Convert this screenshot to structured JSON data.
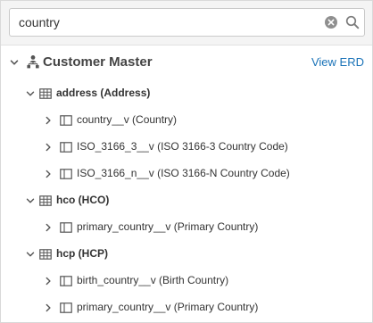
{
  "search": {
    "value": "country",
    "placeholder": ""
  },
  "master": {
    "title": "Customer Master",
    "link_label": "View ERD",
    "icon": "hierarchy-people-icon"
  },
  "tree": [
    {
      "label": "address (Address)",
      "icon": "table-icon",
      "expanded": true,
      "children": [
        {
          "label": "country__v (Country)",
          "icon": "column-icon"
        },
        {
          "label": "ISO_3166_3__v (ISO 3166-3 Country Code)",
          "icon": "column-icon"
        },
        {
          "label": "ISO_3166_n__v (ISO 3166-N Country Code)",
          "icon": "column-icon"
        }
      ]
    },
    {
      "label": "hco (HCO)",
      "icon": "table-icon",
      "expanded": true,
      "children": [
        {
          "label": "primary_country__v (Primary Country)",
          "icon": "column-icon"
        }
      ]
    },
    {
      "label": "hcp (HCP)",
      "icon": "table-icon",
      "expanded": true,
      "children": [
        {
          "label": "birth_country__v (Birth Country)",
          "icon": "column-icon"
        },
        {
          "label": "primary_country__v (Primary Country)",
          "icon": "column-icon"
        }
      ]
    }
  ],
  "colors": {
    "link": "#1a73b8",
    "text": "#333333",
    "toolbar_bg": "#f4f4f4"
  }
}
